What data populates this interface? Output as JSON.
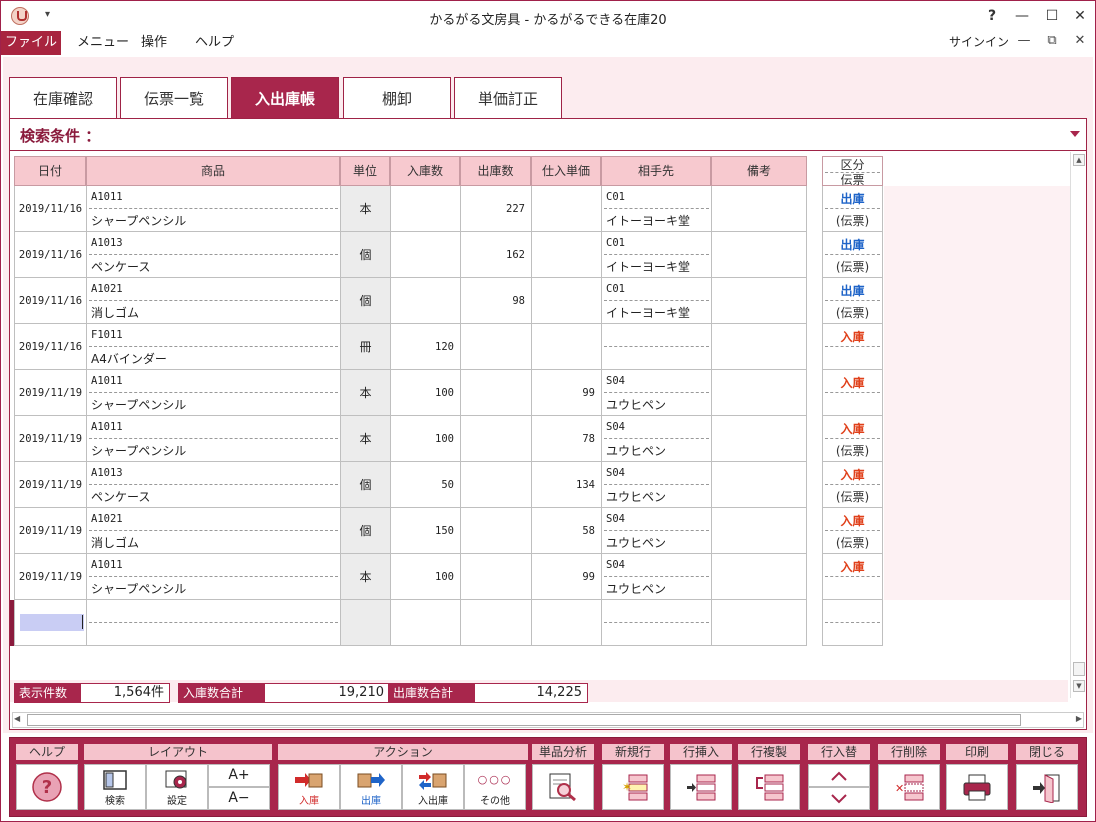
{
  "window": {
    "title": "かるがる文房具 - かるがるできる在庫20",
    "quick_access": "▾",
    "controls": {
      "help": "?",
      "minimize": "—",
      "maximize": "☐",
      "close": "✕"
    }
  },
  "menubar": {
    "file": "ファイル",
    "items": [
      "メニュー",
      "操作",
      "ヘルプ"
    ],
    "signin": "サインイン",
    "controls": {
      "minimize": "—",
      "restore": "⧉",
      "close": "✕"
    }
  },
  "tabs": [
    {
      "label": "在庫確認",
      "active": false
    },
    {
      "label": "伝票一覧",
      "active": false
    },
    {
      "label": "入出庫帳",
      "active": true
    },
    {
      "label": "棚卸",
      "active": false
    },
    {
      "label": "単価訂正",
      "active": false
    }
  ],
  "search": {
    "label": "検索条件 ："
  },
  "table": {
    "headers": [
      "日付",
      "商品",
      "単位",
      "入庫数",
      "出庫数",
      "仕入単価",
      "相手先",
      "備考"
    ],
    "kubun_header": [
      "区分",
      "伝票"
    ],
    "rows": [
      {
        "date": "2019/11/16",
        "code": "A1011",
        "name": "シャープペンシル",
        "unit": "本",
        "in_qty": "",
        "out_qty": "227",
        "price": "",
        "partner_code": "C01",
        "partner_name": "イトーヨーキ堂",
        "note": "",
        "kubun": "出庫",
        "kubun_type": "out",
        "slip": "(伝票)"
      },
      {
        "date": "2019/11/16",
        "code": "A1013",
        "name": "ペンケース",
        "unit": "個",
        "in_qty": "",
        "out_qty": "162",
        "price": "",
        "partner_code": "C01",
        "partner_name": "イトーヨーキ堂",
        "note": "",
        "kubun": "出庫",
        "kubun_type": "out",
        "slip": "(伝票)"
      },
      {
        "date": "2019/11/16",
        "code": "A1021",
        "name": "消しゴム",
        "unit": "個",
        "in_qty": "",
        "out_qty": "98",
        "price": "",
        "partner_code": "C01",
        "partner_name": "イトーヨーキ堂",
        "note": "",
        "kubun": "出庫",
        "kubun_type": "out",
        "slip": "(伝票)"
      },
      {
        "date": "2019/11/16",
        "code": "F1011",
        "name": "A4バインダー",
        "unit": "冊",
        "in_qty": "120",
        "out_qty": "",
        "price": "",
        "partner_code": "",
        "partner_name": "",
        "note": "",
        "kubun": "入庫",
        "kubun_type": "in",
        "slip": ""
      },
      {
        "date": "2019/11/19",
        "code": "A1011",
        "name": "シャープペンシル",
        "unit": "本",
        "in_qty": "100",
        "out_qty": "",
        "price": "99",
        "partner_code": "S04",
        "partner_name": "ユウヒペン",
        "note": "",
        "kubun": "入庫",
        "kubun_type": "in",
        "slip": ""
      },
      {
        "date": "2019/11/19",
        "code": "A1011",
        "name": "シャープペンシル",
        "unit": "本",
        "in_qty": "100",
        "out_qty": "",
        "price": "78",
        "partner_code": "S04",
        "partner_name": "ユウヒペン",
        "note": "",
        "kubun": "入庫",
        "kubun_type": "in",
        "slip": "(伝票)"
      },
      {
        "date": "2019/11/19",
        "code": "A1013",
        "name": "ペンケース",
        "unit": "個",
        "in_qty": "50",
        "out_qty": "",
        "price": "134",
        "partner_code": "S04",
        "partner_name": "ユウヒペン",
        "note": "",
        "kubun": "入庫",
        "kubun_type": "in",
        "slip": "(伝票)"
      },
      {
        "date": "2019/11/19",
        "code": "A1021",
        "name": "消しゴム",
        "unit": "個",
        "in_qty": "150",
        "out_qty": "",
        "price": "58",
        "partner_code": "S04",
        "partner_name": "ユウヒペン",
        "note": "",
        "kubun": "入庫",
        "kubun_type": "in",
        "slip": "(伝票)"
      },
      {
        "date": "2019/11/19",
        "code": "A1011",
        "name": "シャープペンシル",
        "unit": "本",
        "in_qty": "100",
        "out_qty": "",
        "price": "99",
        "partner_code": "S04",
        "partner_name": "ユウヒペン",
        "note": "",
        "kubun": "入庫",
        "kubun_type": "in",
        "slip": ""
      }
    ]
  },
  "totals": {
    "count_label": "表示件数",
    "count_value": "1,564件",
    "in_label": "入庫数合計",
    "in_value": "19,210",
    "out_label": "出庫数合計",
    "out_value": "14,225"
  },
  "toolbar": {
    "help_group": "ヘルプ",
    "layout_group": "レイアウト",
    "action_group": "アクション",
    "analysis_group": "単品分析",
    "new_row_group": "新規行",
    "insert_row_group": "行挿入",
    "copy_row_group": "行複製",
    "swap_row_group": "行入替",
    "delete_row_group": "行削除",
    "print_group": "印刷",
    "close_group": "閉じる",
    "search_btn": "検索",
    "settings_btn": "設定",
    "font_up": "A+",
    "font_down": "A−",
    "in_btn": "入庫",
    "out_btn": "出庫",
    "inout_btn": "入出庫",
    "other_btn": "その他",
    "other_icon": "○○○"
  },
  "colors": {
    "accent": "#a8264c",
    "header_bg": "#f7c9cf",
    "out": "#1f64c8",
    "in": "#e0401a"
  }
}
